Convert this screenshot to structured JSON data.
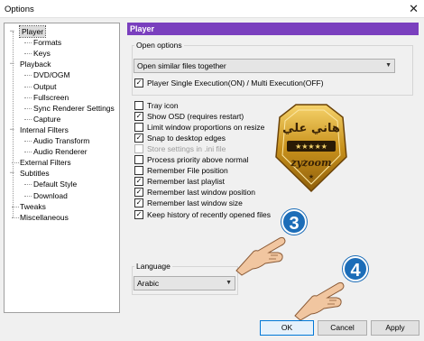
{
  "window": {
    "title": "Options",
    "close_glyph": "✕"
  },
  "tree": [
    {
      "label": "Player",
      "level": 0,
      "expander": "-",
      "selected": true
    },
    {
      "label": "Formats",
      "level": 1
    },
    {
      "label": "Keys",
      "level": 1
    },
    {
      "label": "Playback",
      "level": 0,
      "expander": "-"
    },
    {
      "label": "DVD/OGM",
      "level": 1
    },
    {
      "label": "Output",
      "level": 1
    },
    {
      "label": "Fullscreen",
      "level": 1
    },
    {
      "label": "Sync Renderer Settings",
      "level": 1
    },
    {
      "label": "Capture",
      "level": 1
    },
    {
      "label": "Internal Filters",
      "level": 0,
      "expander": "-"
    },
    {
      "label": "Audio Transform",
      "level": 1
    },
    {
      "label": "Audio Renderer",
      "level": 1
    },
    {
      "label": "External Filters",
      "level": 0
    },
    {
      "label": "Subtitles",
      "level": 0,
      "expander": "-"
    },
    {
      "label": "Default Style",
      "level": 1
    },
    {
      "label": "Download",
      "level": 1
    },
    {
      "label": "Tweaks",
      "level": 0
    },
    {
      "label": "Miscellaneous",
      "level": 0
    }
  ],
  "panel": {
    "header": "Player",
    "open_options_label": "Open options",
    "open_combo_value": "Open similar files together",
    "single_exec_label": "Player Single Execution(ON) / Multi Execution(OFF)",
    "single_exec_checked": true,
    "options": [
      {
        "label": "Tray icon",
        "checked": false
      },
      {
        "label": "Show OSD (requires restart)",
        "checked": true
      },
      {
        "label": "Limit window proportions on resize",
        "checked": false
      },
      {
        "label": "Snap to desktop edges",
        "checked": true
      },
      {
        "label": "Store settings in .ini file",
        "checked": false,
        "disabled": true
      },
      {
        "label": "Process priority above normal",
        "checked": false
      },
      {
        "label": "Remember File position",
        "checked": false
      },
      {
        "label": "Remember last playlist",
        "checked": true
      },
      {
        "label": "Remember last window position",
        "checked": true
      },
      {
        "label": "Remember last window size",
        "checked": true
      },
      {
        "label": "Keep history of recently opened files",
        "checked": true
      }
    ],
    "language_label": "Language",
    "language_value": "Arabic"
  },
  "buttons": {
    "ok": "OK",
    "cancel": "Cancel",
    "apply": "Apply"
  },
  "logo": {
    "top_text": "هاني علي",
    "stars": "★★★★★",
    "bottom_text": "zyzoom",
    "star_small": "★"
  },
  "badges": {
    "step3": "3",
    "step4": "4"
  },
  "icons": {
    "expander": "minus-box-icon",
    "combo": "chevron-down-icon",
    "check": "checkmark-icon",
    "close": "close-icon"
  },
  "colors": {
    "header_bg": "#7a3fbe",
    "badge_bg": "#1c6db8",
    "ok_border": "#0078d7"
  }
}
